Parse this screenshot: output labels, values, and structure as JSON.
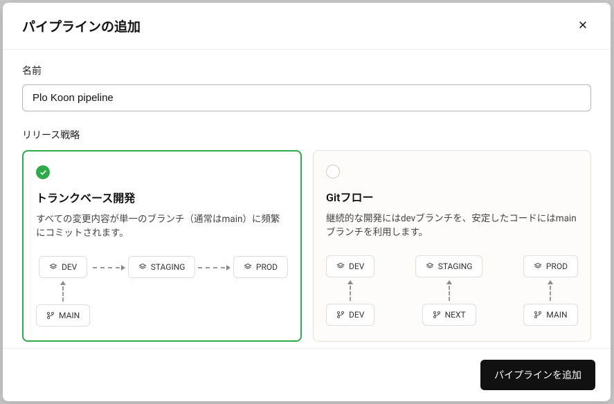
{
  "modal": {
    "title": "パイプラインの追加",
    "name_label": "名前",
    "name_value": "Plo Koon pipeline",
    "strategy_label": "リリース戦略",
    "submit_label": "パイプラインを追加"
  },
  "strategies": {
    "trunk": {
      "title": "トランクベース開発",
      "description": "すべての変更内容が単一のブランチ（通常はmain）に頻繁にコミットされます。",
      "env_dev": "DEV",
      "env_staging": "STAGING",
      "env_prod": "PROD",
      "branch_main": "MAIN"
    },
    "gitflow": {
      "title": "Gitフロー",
      "description": "継続的な開発にはdevブランチを、安定したコードにはmainブランチを利用します。",
      "env_dev": "DEV",
      "env_staging": "STAGING",
      "env_prod": "PROD",
      "branch_dev": "DEV",
      "branch_next": "NEXT",
      "branch_main": "MAIN"
    }
  }
}
